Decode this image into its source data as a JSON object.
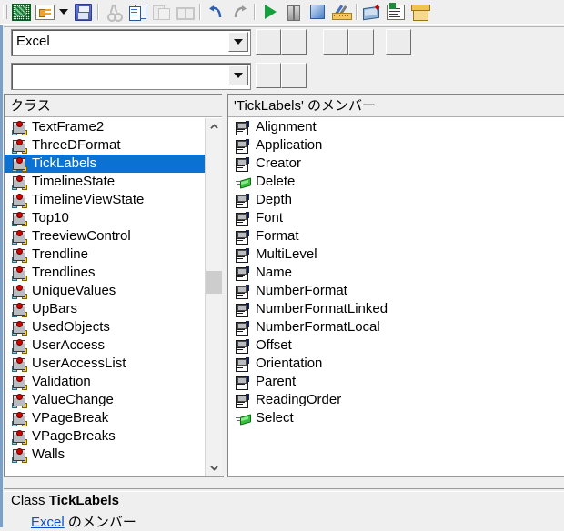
{
  "window": {
    "title": "Object Browser",
    "accent_selection": "#0b72d4",
    "background": "#efefef"
  },
  "toolbar": {
    "buttons": [
      {
        "name": "view-excel-object",
        "icon": "excel-sheet-icon",
        "label": "Excel",
        "enabled": true
      },
      {
        "name": "view-project",
        "icon": "project-window-icon",
        "label": "View Microsoft Excel Object",
        "enabled": true
      },
      {
        "name": "view-dropdown",
        "icon": "chevron-down-icon",
        "label": "View Menu",
        "enabled": true
      },
      {
        "name": "save",
        "icon": "floppy-save-icon",
        "label": "Save",
        "enabled": true
      },
      {
        "name": "cut",
        "icon": "scissors-icon",
        "label": "Cut",
        "enabled": false
      },
      {
        "name": "copy",
        "icon": "copy-pages-icon",
        "label": "Copy",
        "enabled": true
      },
      {
        "name": "paste",
        "icon": "paste-clipboard-icon",
        "label": "Paste",
        "enabled": false
      },
      {
        "name": "find",
        "icon": "find-binoculars-icon",
        "label": "Find",
        "enabled": false
      },
      {
        "name": "undo",
        "icon": "undo-arrow-icon",
        "label": "Undo",
        "enabled": true
      },
      {
        "name": "redo",
        "icon": "redo-arrow-icon",
        "label": "Redo",
        "enabled": false
      },
      {
        "name": "run",
        "icon": "run-play-icon",
        "label": "Run Sub/UserForm",
        "enabled": true
      },
      {
        "name": "break",
        "icon": "break-pause-icon",
        "label": "Break",
        "enabled": true
      },
      {
        "name": "reset",
        "icon": "reset-stop-icon",
        "label": "Reset",
        "enabled": true
      },
      {
        "name": "design-mode",
        "icon": "design-ruler-pen-icon",
        "label": "Design Mode",
        "enabled": true
      },
      {
        "name": "project-explorer",
        "icon": "project-explorer-icon",
        "label": "Project Explorer",
        "enabled": true
      },
      {
        "name": "properties-window",
        "icon": "properties-list-icon",
        "label": "Properties Window",
        "enabled": true
      },
      {
        "name": "object-browser",
        "icon": "object-browser-box-icon",
        "label": "Object Browser",
        "enabled": true
      }
    ]
  },
  "library_combo": {
    "value": "Excel",
    "placeholder": "",
    "dropdown_icon": "chevron-down-icon"
  },
  "search_combo": {
    "value": "",
    "placeholder": "",
    "dropdown_icon": "chevron-down-icon"
  },
  "toolbar_buttons_row1": [
    {
      "name": "go-back-button",
      "label": ""
    },
    {
      "name": "go-forward-button",
      "label": ""
    },
    {
      "name": "copy-to-clipboard-button",
      "label": ""
    },
    {
      "name": "view-definition-button",
      "label": ""
    },
    {
      "name": "help-button",
      "label": ""
    }
  ],
  "toolbar_buttons_row2": [
    {
      "name": "search-button",
      "label": ""
    },
    {
      "name": "show-hide-results-button",
      "label": ""
    }
  ],
  "classes_pane": {
    "header": "クラス",
    "selected": "TickLabels",
    "items": [
      {
        "name": "TextFrame2",
        "icon": "class-icon"
      },
      {
        "name": "ThreeDFormat",
        "icon": "class-icon"
      },
      {
        "name": "TickLabels",
        "icon": "class-icon"
      },
      {
        "name": "TimelineState",
        "icon": "class-icon"
      },
      {
        "name": "TimelineViewState",
        "icon": "class-icon"
      },
      {
        "name": "Top10",
        "icon": "class-icon"
      },
      {
        "name": "TreeviewControl",
        "icon": "class-icon"
      },
      {
        "name": "Trendline",
        "icon": "class-icon"
      },
      {
        "name": "Trendlines",
        "icon": "class-icon"
      },
      {
        "name": "UniqueValues",
        "icon": "class-icon"
      },
      {
        "name": "UpBars",
        "icon": "class-icon"
      },
      {
        "name": "UsedObjects",
        "icon": "class-icon"
      },
      {
        "name": "UserAccess",
        "icon": "class-icon"
      },
      {
        "name": "UserAccessList",
        "icon": "class-icon"
      },
      {
        "name": "Validation",
        "icon": "class-icon"
      },
      {
        "name": "ValueChange",
        "icon": "class-icon"
      },
      {
        "name": "VPageBreak",
        "icon": "class-icon"
      },
      {
        "name": "VPageBreaks",
        "icon": "class-icon"
      },
      {
        "name": "Walls",
        "icon": "class-icon"
      }
    ],
    "scrollbar": {
      "up_icon": "chevron-up-icon",
      "down_icon": "chevron-down-icon",
      "thumb_top_pct": 42,
      "thumb_height_pct": 7
    }
  },
  "members_pane": {
    "header": "'TickLabels' のメンバー",
    "items": [
      {
        "name": "Alignment",
        "icon": "property-icon"
      },
      {
        "name": "Application",
        "icon": "property-icon"
      },
      {
        "name": "Creator",
        "icon": "property-icon"
      },
      {
        "name": "Delete",
        "icon": "method-icon"
      },
      {
        "name": "Depth",
        "icon": "property-icon"
      },
      {
        "name": "Font",
        "icon": "property-icon"
      },
      {
        "name": "Format",
        "icon": "property-icon"
      },
      {
        "name": "MultiLevel",
        "icon": "property-icon"
      },
      {
        "name": "Name",
        "icon": "property-icon"
      },
      {
        "name": "NumberFormat",
        "icon": "property-icon"
      },
      {
        "name": "NumberFormatLinked",
        "icon": "property-icon"
      },
      {
        "name": "NumberFormatLocal",
        "icon": "property-icon"
      },
      {
        "name": "Offset",
        "icon": "property-icon"
      },
      {
        "name": "Orientation",
        "icon": "property-icon"
      },
      {
        "name": "Parent",
        "icon": "property-icon"
      },
      {
        "name": "ReadingOrder",
        "icon": "property-icon"
      },
      {
        "name": "Select",
        "icon": "method-icon"
      }
    ]
  },
  "detail_pane": {
    "kind_label": "Class",
    "class_name": "TickLabels",
    "member_of_link": "Excel",
    "member_of_suffix": " のメンバー"
  }
}
